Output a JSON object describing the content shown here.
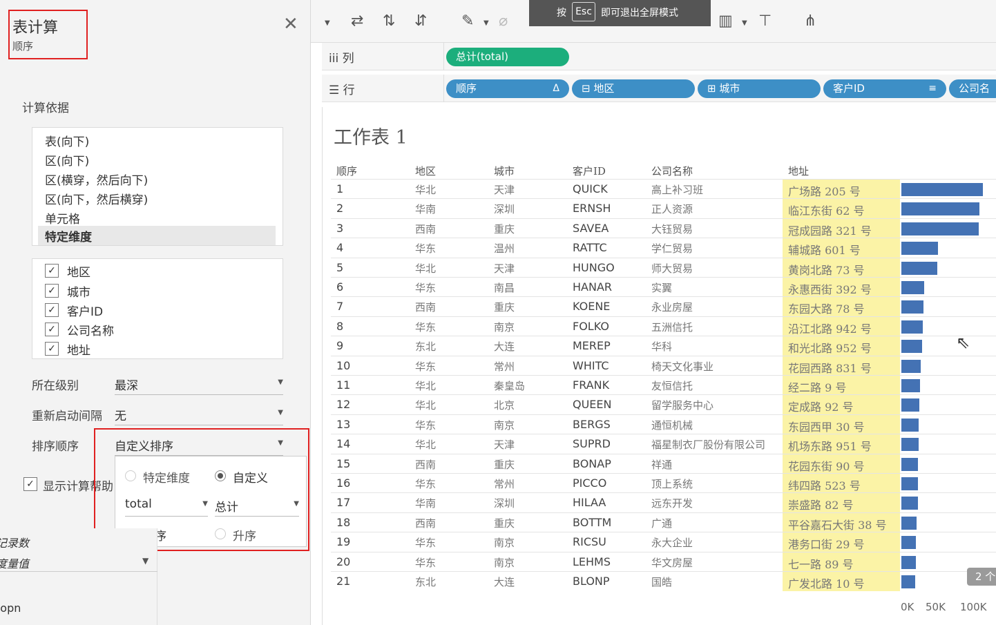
{
  "dialog": {
    "title": "表计算",
    "subtitle": "顺序",
    "calc_basis_label": "计算依据",
    "basis_options": [
      "表(向下)",
      "区(向下)",
      "区(横穿，然后向下)",
      "区(向下，然后横穿)",
      "单元格",
      "特定维度"
    ],
    "selected_basis": "特定维度",
    "dimensions": [
      {
        "label": "地区",
        "checked": true
      },
      {
        "label": "城市",
        "checked": true
      },
      {
        "label": "客户ID",
        "checked": true
      },
      {
        "label": "公司名称",
        "checked": true
      },
      {
        "label": "地址",
        "checked": true
      }
    ],
    "level_label": "所在级别",
    "level_value": "最深",
    "restart_label": "重新启动间隔",
    "restart_value": "无",
    "sort_label": "排序顺序",
    "sort_value": "自定义排序",
    "sort_popup": {
      "opt_specific": "特定维度",
      "opt_custom": "自定义",
      "field": "total",
      "aggregation": "总计",
      "opt_desc": "降序",
      "opt_asc": "升序"
    },
    "show_helper_label": "显示计算帮助"
  },
  "data_pane": {
    "item1": "记录数",
    "item2": "度量值",
    "item3": "topn"
  },
  "esc_banner": {
    "press": "按",
    "key": "Esc",
    "text": "即可退出全屏模式"
  },
  "shelves": {
    "columns_label": "列",
    "rows_label": "行",
    "columns_pills": [
      "总计(total)"
    ],
    "rows_pills": [
      "顺序",
      "地区",
      "城市",
      "客户ID",
      "公司名"
    ]
  },
  "sheet": {
    "title": "工作表 1",
    "headers": [
      "顺序",
      "地区",
      "城市",
      "客户ID",
      "公司名称",
      "地址"
    ],
    "rows": [
      {
        "n": "1",
        "region": "华北",
        "city": "天津",
        "id": "QUICK",
        "company": "高上补习班",
        "addr": "广场路 205 号",
        "total": 100
      },
      {
        "n": "2",
        "region": "华南",
        "city": "深圳",
        "id": "ERNSH",
        "company": "正人资源",
        "addr": "临江东街 62 号",
        "total": 96
      },
      {
        "n": "3",
        "region": "西南",
        "city": "重庆",
        "id": "SAVEA",
        "company": "大钰贸易",
        "addr": "冠成园路 321 号",
        "total": 95
      },
      {
        "n": "4",
        "region": "华东",
        "city": "温州",
        "id": "RATTC",
        "company": "学仁贸易",
        "addr": "辅城路 601 号",
        "total": 45
      },
      {
        "n": "5",
        "region": "华北",
        "city": "天津",
        "id": "HUNGO",
        "company": "师大贸易",
        "addr": "黄岗北路 73 号",
        "total": 44
      },
      {
        "n": "6",
        "region": "华东",
        "city": "南昌",
        "id": "HANAR",
        "company": "实翼",
        "addr": "永惠西街 392 号",
        "total": 28
      },
      {
        "n": "7",
        "region": "西南",
        "city": "重庆",
        "id": "KOENE",
        "company": "永业房屋",
        "addr": "东园大路 78 号",
        "total": 27
      },
      {
        "n": "8",
        "region": "华东",
        "city": "南京",
        "id": "FOLKO",
        "company": "五洲信托",
        "addr": "沿江北路 942 号",
        "total": 26
      },
      {
        "n": "9",
        "region": "东北",
        "city": "大连",
        "id": "MEREP",
        "company": "华科",
        "addr": "和光北路 952 号",
        "total": 25
      },
      {
        "n": "10",
        "region": "华东",
        "city": "常州",
        "id": "WHITC",
        "company": "椅天文化事业",
        "addr": "花园西路 831 号",
        "total": 24
      },
      {
        "n": "11",
        "region": "华北",
        "city": "秦皇岛",
        "id": "FRANK",
        "company": "友恒信托",
        "addr": "经二路 9 号",
        "total": 23
      },
      {
        "n": "12",
        "region": "华北",
        "city": "北京",
        "id": "QUEEN",
        "company": "留学服务中心",
        "addr": "定成路 92 号",
        "total": 22
      },
      {
        "n": "13",
        "region": "华东",
        "city": "南京",
        "id": "BERGS",
        "company": "通恒机械",
        "addr": "东园西甲 30 号",
        "total": 21
      },
      {
        "n": "14",
        "region": "华北",
        "city": "天津",
        "id": "SUPRD",
        "company": "福星制衣厂股份有限公司",
        "addr": "机场东路 951 号",
        "total": 21
      },
      {
        "n": "15",
        "region": "西南",
        "city": "重庆",
        "id": "BONAP",
        "company": "祥通",
        "addr": "花园东街 90 号",
        "total": 20
      },
      {
        "n": "16",
        "region": "华东",
        "city": "常州",
        "id": "PICCO",
        "company": "顶上系统",
        "addr": "纬四路 523 号",
        "total": 20
      },
      {
        "n": "17",
        "region": "华南",
        "city": "深圳",
        "id": "HILAA",
        "company": "远东开发",
        "addr": "崇盛路 82 号",
        "total": 20
      },
      {
        "n": "18",
        "region": "西南",
        "city": "重庆",
        "id": "BOTTM",
        "company": "广通",
        "addr": "平谷嘉石大街 38 号",
        "total": 19
      },
      {
        "n": "19",
        "region": "华东",
        "city": "南京",
        "id": "RICSU",
        "company": "永大企业",
        "addr": "港务口街 29 号",
        "total": 18
      },
      {
        "n": "20",
        "region": "华东",
        "city": "南京",
        "id": "LEHMS",
        "company": "华文房屋",
        "addr": "七一路 89 号",
        "total": 18
      },
      {
        "n": "21",
        "region": "东北",
        "city": "大连",
        "id": "BLONP",
        "company": "国皓",
        "addr": "广发北路 10 号",
        "total": 17
      }
    ],
    "axis_ticks": [
      "0K",
      "50K",
      "100K"
    ],
    "badge": "2 个"
  },
  "colors": {
    "bar": "#4472b4",
    "highlight": "#fbf3a6",
    "pill_green": "#1cae7c",
    "pill_blue": "#3d8fc6",
    "annotation_red": "#e02020"
  }
}
